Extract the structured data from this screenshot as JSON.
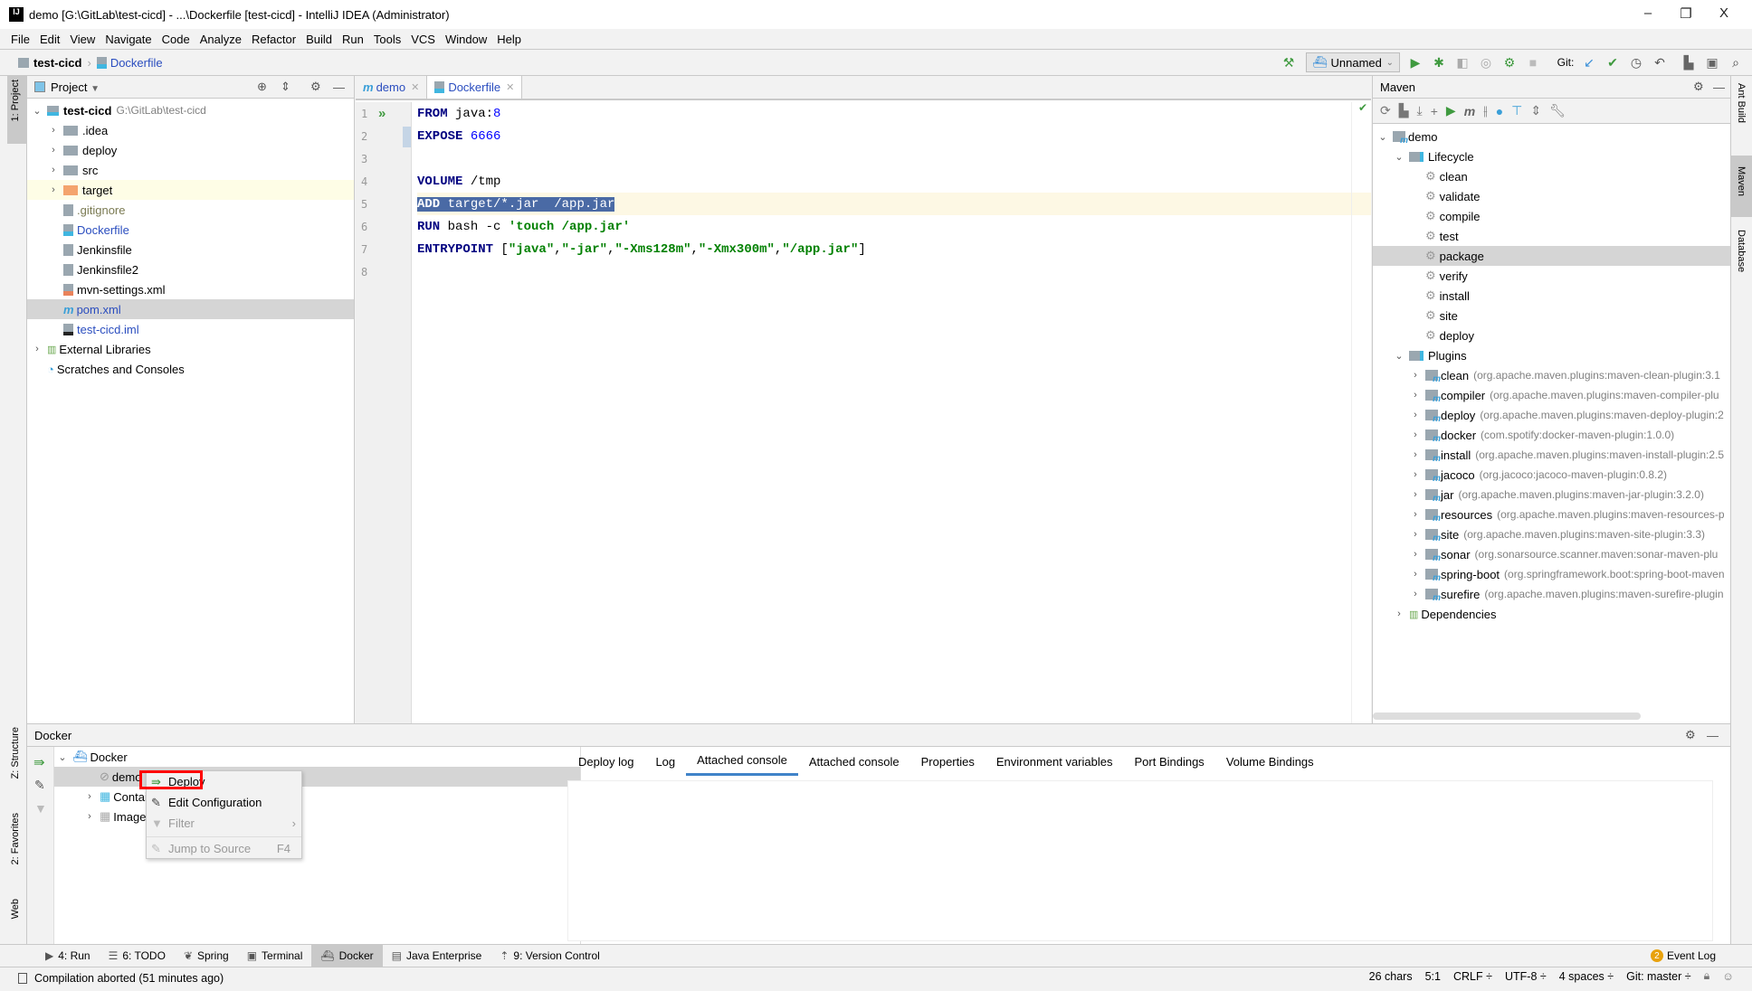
{
  "window": {
    "title": "demo [G:\\GitLab\\test-cicd] - ...\\Dockerfile [test-cicd] - IntelliJ IDEA (Administrator)",
    "app_icon": "IJ",
    "minimize": "–",
    "restore": "❐",
    "close": "X"
  },
  "menu": [
    "File",
    "Edit",
    "View",
    "Navigate",
    "Code",
    "Analyze",
    "Refactor",
    "Build",
    "Run",
    "Tools",
    "VCS",
    "Window",
    "Help"
  ],
  "breadcrumb": {
    "project": "test-cicd",
    "file": "Dockerfile"
  },
  "toolbar": {
    "run_config": "Unnamed",
    "git_label": "Git:"
  },
  "left_strip": {
    "project": "1: Project",
    "structure": "Z: Structure",
    "favorites": "2: Favorites",
    "web": "Web"
  },
  "right_strip": {
    "ant": "Ant Build",
    "maven": "Maven",
    "database": "Database"
  },
  "project": {
    "title": "Project",
    "items": [
      {
        "label": "test-cicd",
        "extra": "G:\\GitLab\\test-cicd",
        "depth": 0,
        "chevron": "down",
        "icon": "module",
        "bold": true
      },
      {
        "label": ".idea",
        "depth": 1,
        "chevron": "right",
        "icon": "folder"
      },
      {
        "label": "deploy",
        "depth": 1,
        "chevron": "right",
        "icon": "folder"
      },
      {
        "label": "src",
        "depth": 1,
        "chevron": "right",
        "icon": "folder"
      },
      {
        "label": "target",
        "depth": 1,
        "chevron": "right",
        "icon": "folder-orange",
        "highlight": "#fefde6"
      },
      {
        "label": ".gitignore",
        "depth": 1,
        "icon": "text",
        "color": "#7a7a52"
      },
      {
        "label": "Dockerfile",
        "depth": 1,
        "icon": "docker-file",
        "color": "#2a4dbf"
      },
      {
        "label": "Jenkinsfile",
        "depth": 1,
        "icon": "text"
      },
      {
        "label": "Jenkinsfile2",
        "depth": 1,
        "icon": "text"
      },
      {
        "label": "mvn-settings.xml",
        "depth": 1,
        "icon": "xml"
      },
      {
        "label": "pom.xml",
        "depth": 1,
        "icon": "maven",
        "color": "#2a4dbf",
        "selected": true
      },
      {
        "label": "test-cicd.iml",
        "depth": 1,
        "icon": "iml",
        "color": "#2a4dbf"
      },
      {
        "label": "External Libraries",
        "depth": 0,
        "chevron": "right",
        "icon": "library"
      },
      {
        "label": "Scratches and Consoles",
        "depth": 0,
        "icon": "scratch"
      }
    ]
  },
  "editor": {
    "tabs": [
      {
        "label": "demo",
        "icon": "maven"
      },
      {
        "label": "Dockerfile",
        "icon": "docker-file",
        "active": true
      }
    ],
    "line_numbers": [
      "1",
      "2",
      "3",
      "4",
      "5",
      "6",
      "7",
      "8"
    ],
    "lines": [
      [
        {
          "t": "FROM",
          "c": "kw"
        },
        {
          "t": " java:"
        },
        {
          "t": "8",
          "c": "num"
        }
      ],
      [
        {
          "t": "EXPOSE",
          "c": "kw"
        },
        {
          "t": " "
        },
        {
          "t": "6666",
          "c": "num"
        }
      ],
      [],
      [
        {
          "t": "VOLUME",
          "c": "kw"
        },
        {
          "t": " /tmp"
        }
      ],
      [
        {
          "t": "ADD",
          "c": "kw sel"
        },
        {
          "t": " target/*.jar  /app.jar",
          "c": "sel"
        }
      ],
      [
        {
          "t": "RUN",
          "c": "kw"
        },
        {
          "t": " bash -c "
        },
        {
          "t": "'touch /app.jar'",
          "c": "str"
        }
      ],
      [
        {
          "t": "ENTRYPOINT",
          "c": "kw"
        },
        {
          "t": " ["
        },
        {
          "t": "\"java\"",
          "c": "str"
        },
        {
          "t": ","
        },
        {
          "t": "\"-jar\"",
          "c": "str"
        },
        {
          "t": ","
        },
        {
          "t": "\"-Xms128m\"",
          "c": "str"
        },
        {
          "t": ","
        },
        {
          "t": "\"-Xmx300m\"",
          "c": "str"
        },
        {
          "t": ","
        },
        {
          "t": "\"/app.jar\"",
          "c": "str"
        },
        {
          "t": "]"
        }
      ],
      []
    ],
    "current_line": 5
  },
  "maven": {
    "title": "Maven",
    "items": [
      {
        "label": "demo",
        "depth": 0,
        "chevron": "down",
        "icon": "maven-module"
      },
      {
        "label": "Lifecycle",
        "depth": 1,
        "chevron": "down",
        "icon": "folder-gear"
      },
      {
        "label": "clean",
        "depth": 2,
        "icon": "gear"
      },
      {
        "label": "validate",
        "depth": 2,
        "icon": "gear"
      },
      {
        "label": "compile",
        "depth": 2,
        "icon": "gear"
      },
      {
        "label": "test",
        "depth": 2,
        "icon": "gear"
      },
      {
        "label": "package",
        "depth": 2,
        "icon": "gear",
        "selected": true
      },
      {
        "label": "verify",
        "depth": 2,
        "icon": "gear"
      },
      {
        "label": "install",
        "depth": 2,
        "icon": "gear"
      },
      {
        "label": "site",
        "depth": 2,
        "icon": "gear"
      },
      {
        "label": "deploy",
        "depth": 2,
        "icon": "gear"
      },
      {
        "label": "Plugins",
        "depth": 1,
        "chevron": "down",
        "icon": "folder-gear"
      },
      {
        "label": "clean",
        "extra": "(org.apache.maven.plugins:maven-clean-plugin:3.1",
        "depth": 2,
        "chevron": "right",
        "icon": "plugin"
      },
      {
        "label": "compiler",
        "extra": "(org.apache.maven.plugins:maven-compiler-plu",
        "depth": 2,
        "chevron": "right",
        "icon": "plugin"
      },
      {
        "label": "deploy",
        "extra": "(org.apache.maven.plugins:maven-deploy-plugin:2",
        "depth": 2,
        "chevron": "right",
        "icon": "plugin"
      },
      {
        "label": "docker",
        "extra": "(com.spotify:docker-maven-plugin:1.0.0)",
        "depth": 2,
        "chevron": "right",
        "icon": "plugin"
      },
      {
        "label": "install",
        "extra": "(org.apache.maven.plugins:maven-install-plugin:2.5",
        "depth": 2,
        "chevron": "right",
        "icon": "plugin"
      },
      {
        "label": "jacoco",
        "extra": "(org.jacoco:jacoco-maven-plugin:0.8.2)",
        "depth": 2,
        "chevron": "right",
        "icon": "plugin"
      },
      {
        "label": "jar",
        "extra": "(org.apache.maven.plugins:maven-jar-plugin:3.2.0)",
        "depth": 2,
        "chevron": "right",
        "icon": "plugin"
      },
      {
        "label": "resources",
        "extra": "(org.apache.maven.plugins:maven-resources-p",
        "depth": 2,
        "chevron": "right",
        "icon": "plugin"
      },
      {
        "label": "site",
        "extra": "(org.apache.maven.plugins:maven-site-plugin:3.3)",
        "depth": 2,
        "chevron": "right",
        "icon": "plugin"
      },
      {
        "label": "sonar",
        "extra": "(org.sonarsource.scanner.maven:sonar-maven-plu",
        "depth": 2,
        "chevron": "right",
        "icon": "plugin"
      },
      {
        "label": "spring-boot",
        "extra": "(org.springframework.boot:spring-boot-maven",
        "depth": 2,
        "chevron": "right",
        "icon": "plugin"
      },
      {
        "label": "surefire",
        "extra": "(org.apache.maven.plugins:maven-surefire-plugin",
        "depth": 2,
        "chevron": "right",
        "icon": "plugin"
      },
      {
        "label": "Dependencies",
        "depth": 1,
        "chevron": "right",
        "icon": "library"
      }
    ]
  },
  "docker": {
    "title": "Docker",
    "tree": [
      {
        "label": "Docker",
        "depth": 0,
        "chevron": "down",
        "icon": "docker"
      },
      {
        "label": "demo D",
        "depth": 1,
        "icon": "disabled",
        "selected": true
      },
      {
        "label": "Contair",
        "depth": 1,
        "chevron": "right",
        "icon": "containers"
      },
      {
        "label": "Images",
        "depth": 1,
        "chevron": "right",
        "icon": "images"
      }
    ],
    "tabs": [
      "Deploy log",
      "Log",
      "Attached console",
      "Attached console",
      "Properties",
      "Environment variables",
      "Port Bindings",
      "Volume Bindings"
    ],
    "active_tab": 2,
    "context_menu": [
      {
        "label": "Deploy",
        "icon": "deploy-icon",
        "highlighted": true
      },
      {
        "label": "Edit Configuration",
        "icon": "edit-icon"
      },
      {
        "label": "Filter",
        "icon": "filter-icon",
        "disabled": true,
        "submenu": true
      },
      {
        "label": "Jump to Source",
        "icon": "jump-icon",
        "disabled": true,
        "shortcut": "F4"
      }
    ],
    "highlight_color": "#ff0000"
  },
  "tool_windows": [
    {
      "label": "4: Run",
      "icon": "▶"
    },
    {
      "label": "6: TODO",
      "icon": "☰"
    },
    {
      "label": "Spring",
      "icon": "❦"
    },
    {
      "label": "Terminal",
      "icon": "▣"
    },
    {
      "label": "Docker",
      "icon": "⛴",
      "active": true
    },
    {
      "label": "Java Enterprise",
      "icon": "▤"
    },
    {
      "label": "9: Version Control",
      "icon": "⇡"
    }
  ],
  "event_log": {
    "count": "2",
    "label": "Event Log"
  },
  "status": {
    "message": "Compilation aborted (51 minutes ago)",
    "chars": "26 chars",
    "position": "5:1",
    "line_sep": "CRLF ÷",
    "encoding": "UTF-8 ÷",
    "indent": "4 spaces ÷",
    "git": "Git: master ÷"
  }
}
